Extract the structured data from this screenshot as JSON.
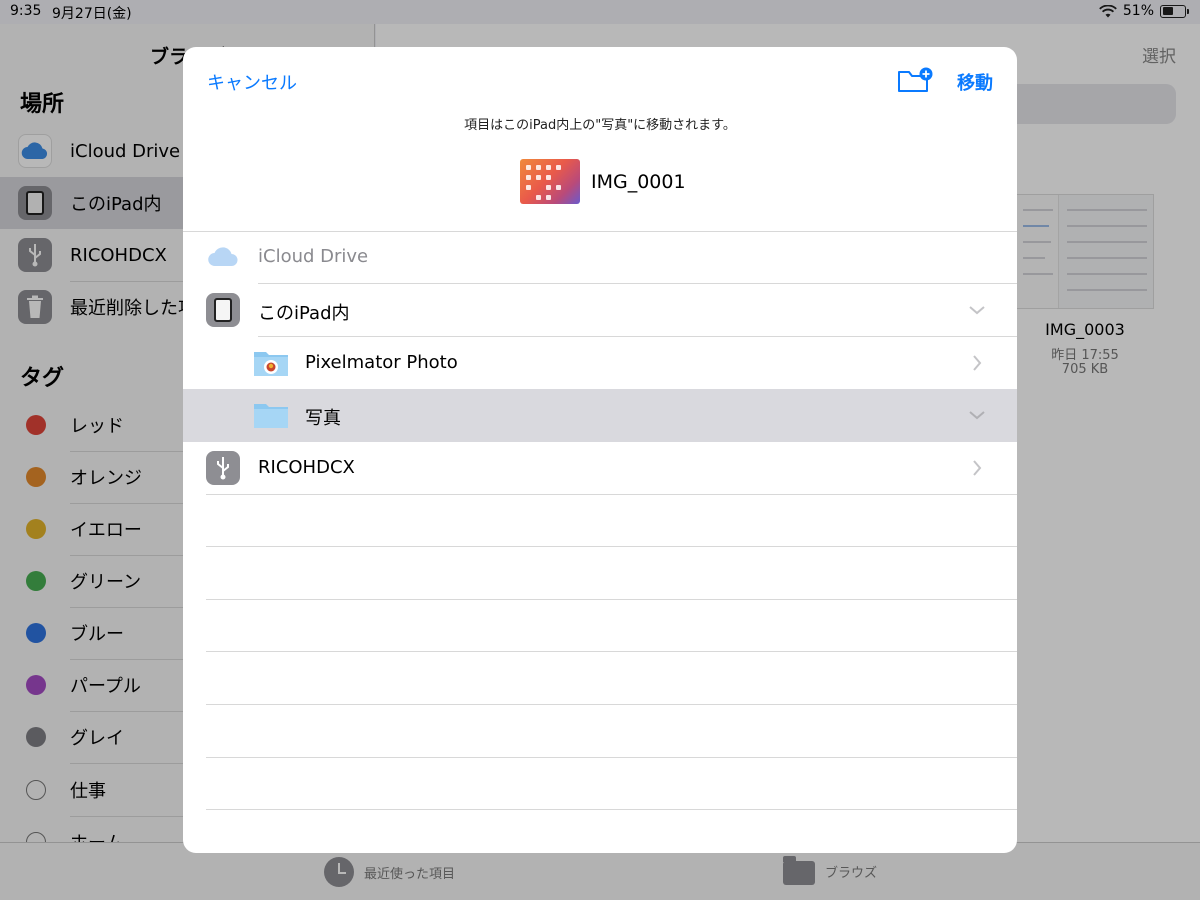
{
  "status": {
    "time": "9:35",
    "date": "9月27日(金)",
    "battery": "51%",
    "battery_level": 0.51
  },
  "sidebar": {
    "title": "ブラウズ",
    "locations_title": "場所",
    "locations": [
      {
        "label": "iCloud Drive",
        "icon": "icloud-icon"
      },
      {
        "label": "このiPad内",
        "icon": "ipad-icon"
      },
      {
        "label": "RICOHDCX",
        "icon": "usb-icon"
      },
      {
        "label": "最近削除した項目",
        "icon": "trash-icon"
      }
    ],
    "tags_title": "タグ",
    "tags": [
      {
        "label": "レッド",
        "color": "#e0453a"
      },
      {
        "label": "オレンジ",
        "color": "#e38a2c"
      },
      {
        "label": "イエロー",
        "color": "#e2b32a"
      },
      {
        "label": "グリーン",
        "color": "#47ad52"
      },
      {
        "label": "ブルー",
        "color": "#2f74e0"
      },
      {
        "label": "パープル",
        "color": "#a44bc4"
      },
      {
        "label": "グレイ",
        "color": "#7f7f84"
      },
      {
        "label": "仕事",
        "color": "none"
      },
      {
        "label": "ホーム",
        "color": "none"
      }
    ]
  },
  "main": {
    "select_label": "選択",
    "file": {
      "name": "IMG_0003",
      "date": "昨日 17:55",
      "size": "705 KB"
    }
  },
  "tabbar": {
    "recents": "最近使った項目",
    "browse": "ブラウズ"
  },
  "modal": {
    "cancel": "キャンセル",
    "move": "移動",
    "message": "項目はこのiPad内上の\"写真\"に移動されます。",
    "item_name": "IMG_0001",
    "accent": "#0a7aff",
    "rows": [
      {
        "label": "iCloud Drive",
        "icon": "icloud-icon",
        "enabled": false
      },
      {
        "label": "このiPad内",
        "icon": "ipad-icon",
        "expanded": true
      },
      {
        "label": "Pixelmator Photo",
        "icon": "pixelmator-folder-icon",
        "chevron": "right"
      },
      {
        "label": "写真",
        "icon": "folder-icon",
        "expanded": true,
        "selected": true
      },
      {
        "label": "RICOHDCX",
        "icon": "usb-icon",
        "chevron": "right"
      }
    ]
  }
}
